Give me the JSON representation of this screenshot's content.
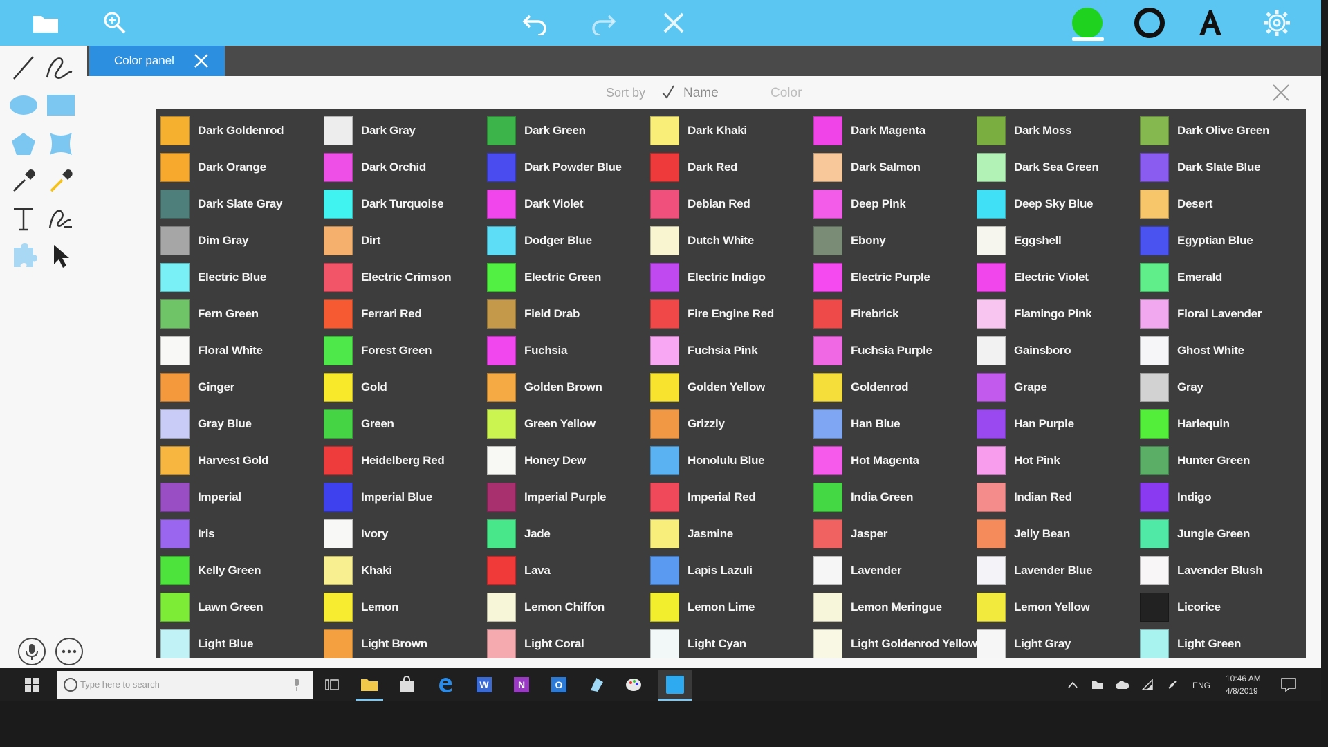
{
  "tab": {
    "label": "Color panel"
  },
  "sort": {
    "label": "Sort by",
    "name": "Name",
    "color": "Color"
  },
  "taskbar": {
    "search_placeholder": "Type here to search",
    "lang": "ENG",
    "time": "10:46 AM",
    "date": "4/8/2019"
  },
  "colors": [
    {
      "name": "Dark Goldenrod",
      "hex": "#F5B030"
    },
    {
      "name": "Dark Gray",
      "hex": "#EDEDED"
    },
    {
      "name": "Dark Green",
      "hex": "#3CB44A"
    },
    {
      "name": "Dark Khaki",
      "hex": "#F8EE78"
    },
    {
      "name": "Dark Magenta",
      "hex": "#F044E8"
    },
    {
      "name": "Dark Moss",
      "hex": "#7AAE40"
    },
    {
      "name": "Dark Olive Green",
      "hex": "#86B850"
    },
    {
      "name": "Dark Orange",
      "hex": "#F7A92E"
    },
    {
      "name": "Dark Orchid",
      "hex": "#EE4FE6"
    },
    {
      "name": "Dark Powder Blue",
      "hex": "#4A4CF0"
    },
    {
      "name": "Dark Red",
      "hex": "#EE3A3A"
    },
    {
      "name": "Dark Salmon",
      "hex": "#F8C89A"
    },
    {
      "name": "Dark Sea Green",
      "hex": "#B2F2B6"
    },
    {
      "name": "Dark Slate Blue",
      "hex": "#8A5CF0"
    },
    {
      "name": "Dark Slate Gray",
      "hex": "#4F7F7A"
    },
    {
      "name": "Dark Turquoise",
      "hex": "#40F2F0"
    },
    {
      "name": "Dark Violet",
      "hex": "#F046EC"
    },
    {
      "name": "Debian Red",
      "hex": "#F0507C"
    },
    {
      "name": "Deep Pink",
      "hex": "#F35CE8"
    },
    {
      "name": "Deep Sky Blue",
      "hex": "#40E0F6"
    },
    {
      "name": "Desert",
      "hex": "#F8C66A"
    },
    {
      "name": "Dim Gray",
      "hex": "#A6A6A6"
    },
    {
      "name": "Dirt",
      "hex": "#F6B06E"
    },
    {
      "name": "Dodger Blue",
      "hex": "#5EDDF6"
    },
    {
      "name": "Dutch White",
      "hex": "#F8F5D0"
    },
    {
      "name": "Ebony",
      "hex": "#7A8C76"
    },
    {
      "name": "Eggshell",
      "hex": "#F6F6EE"
    },
    {
      "name": "Egyptian Blue",
      "hex": "#4A52F0"
    },
    {
      "name": "Electric Blue",
      "hex": "#78F0F6"
    },
    {
      "name": "Electric Crimson",
      "hex": "#F25468"
    },
    {
      "name": "Electric Green",
      "hex": "#52F042"
    },
    {
      "name": "Electric Indigo",
      "hex": "#C04AF0"
    },
    {
      "name": "Electric Purple",
      "hex": "#F54AF0"
    },
    {
      "name": "Electric Violet",
      "hex": "#F046EC"
    },
    {
      "name": "Emerald",
      "hex": "#60EE8A"
    },
    {
      "name": "Fern Green",
      "hex": "#6EC466"
    },
    {
      "name": "Ferrari Red",
      "hex": "#F55A32"
    },
    {
      "name": "Field Drab",
      "hex": "#C49A4A"
    },
    {
      "name": "Fire Engine Red",
      "hex": "#F04848"
    },
    {
      "name": "Firebrick",
      "hex": "#EE4A4A"
    },
    {
      "name": "Flamingo Pink",
      "hex": "#F8C4F0"
    },
    {
      "name": "Floral Lavender",
      "hex": "#F2A8EE"
    },
    {
      "name": "Floral White",
      "hex": "#F8F8F6"
    },
    {
      "name": "Forest Green",
      "hex": "#4EE84A"
    },
    {
      "name": "Fuchsia",
      "hex": "#F048EE"
    },
    {
      "name": "Fuchsia Pink",
      "hex": "#F8A8F2"
    },
    {
      "name": "Fuchsia Purple",
      "hex": "#F068E4"
    },
    {
      "name": "Gainsboro",
      "hex": "#F2F2F2"
    },
    {
      "name": "Ghost White",
      "hex": "#F6F6F8"
    },
    {
      "name": "Ginger",
      "hex": "#F59A3C"
    },
    {
      "name": "Gold",
      "hex": "#F8EA2A"
    },
    {
      "name": "Golden Brown",
      "hex": "#F5AA44"
    },
    {
      "name": "Golden Yellow",
      "hex": "#F8E42E"
    },
    {
      "name": "Goldenrod",
      "hex": "#F5DE3A"
    },
    {
      "name": "Grape",
      "hex": "#C25AEE"
    },
    {
      "name": "Gray",
      "hex": "#D2D2D2"
    },
    {
      "name": "Gray Blue",
      "hex": "#C8CCF6"
    },
    {
      "name": "Green",
      "hex": "#44D444"
    },
    {
      "name": "Green Yellow",
      "hex": "#CCF450"
    },
    {
      "name": "Grizzly",
      "hex": "#F09844"
    },
    {
      "name": "Han Blue",
      "hex": "#7EA6F2"
    },
    {
      "name": "Han Purple",
      "hex": "#9A48F0"
    },
    {
      "name": "Harlequin",
      "hex": "#52EE3A"
    },
    {
      "name": "Harvest Gold",
      "hex": "#F6B640"
    },
    {
      "name": "Heidelberg Red",
      "hex": "#EE3C3C"
    },
    {
      "name": "Honey Dew",
      "hex": "#F8F8F4"
    },
    {
      "name": "Honolulu Blue",
      "hex": "#5AB2F2"
    },
    {
      "name": "Hot Magenta",
      "hex": "#F55AEA"
    },
    {
      "name": "Hot Pink",
      "hex": "#F89CEE"
    },
    {
      "name": "Hunter Green",
      "hex": "#5AAE66"
    },
    {
      "name": "Imperial",
      "hex": "#9A4EC4"
    },
    {
      "name": "Imperial Blue",
      "hex": "#3E42EE"
    },
    {
      "name": "Imperial Purple",
      "hex": "#A8306E"
    },
    {
      "name": "Imperial Red",
      "hex": "#F04A5A"
    },
    {
      "name": "India Green",
      "hex": "#44D844"
    },
    {
      "name": "Indian Red",
      "hex": "#F48C8C"
    },
    {
      "name": "Indigo",
      "hex": "#8A3AF0"
    },
    {
      "name": "Iris",
      "hex": "#9A66F0"
    },
    {
      "name": "Ivory",
      "hex": "#F8F8F6"
    },
    {
      "name": "Jade",
      "hex": "#48E88A"
    },
    {
      "name": "Jasmine",
      "hex": "#F8EE7C"
    },
    {
      "name": "Jasper",
      "hex": "#F06262"
    },
    {
      "name": "Jelly Bean",
      "hex": "#F58A5A"
    },
    {
      "name": "Jungle Green",
      "hex": "#50EAA6"
    },
    {
      "name": "Kelly Green",
      "hex": "#4EE23C"
    },
    {
      "name": "Khaki",
      "hex": "#F8F090"
    },
    {
      "name": "Lava",
      "hex": "#F03A3A"
    },
    {
      "name": "Lapis Lazuli",
      "hex": "#5A9AF0"
    },
    {
      "name": "Lavender",
      "hex": "#F6F6F6"
    },
    {
      "name": "Lavender Blue",
      "hex": "#F4F4F8"
    },
    {
      "name": "Lavender Blush",
      "hex": "#F8F6F6"
    },
    {
      "name": "Lawn Green",
      "hex": "#7CEC36"
    },
    {
      "name": "Lemon",
      "hex": "#F8EC30"
    },
    {
      "name": "Lemon Chiffon",
      "hex": "#F8F6D8"
    },
    {
      "name": "Lemon Lime",
      "hex": "#F2EE2E"
    },
    {
      "name": "Lemon Meringue",
      "hex": "#F8F6DA"
    },
    {
      "name": "Lemon Yellow",
      "hex": "#F2EA3C"
    },
    {
      "name": "Licorice",
      "hex": "#222222"
    },
    {
      "name": "Light Blue",
      "hex": "#C0F2F6"
    },
    {
      "name": "Light Brown",
      "hex": "#F5A040"
    },
    {
      "name": "Light Coral",
      "hex": "#F5AAB0"
    },
    {
      "name": "Light Cyan",
      "hex": "#F2F8F8"
    },
    {
      "name": "Light Goldenrod Yellow",
      "hex": "#F8F8E4"
    },
    {
      "name": "Light Gray",
      "hex": "#F6F6F6"
    },
    {
      "name": "Light Green",
      "hex": "#A8F2F0"
    }
  ]
}
